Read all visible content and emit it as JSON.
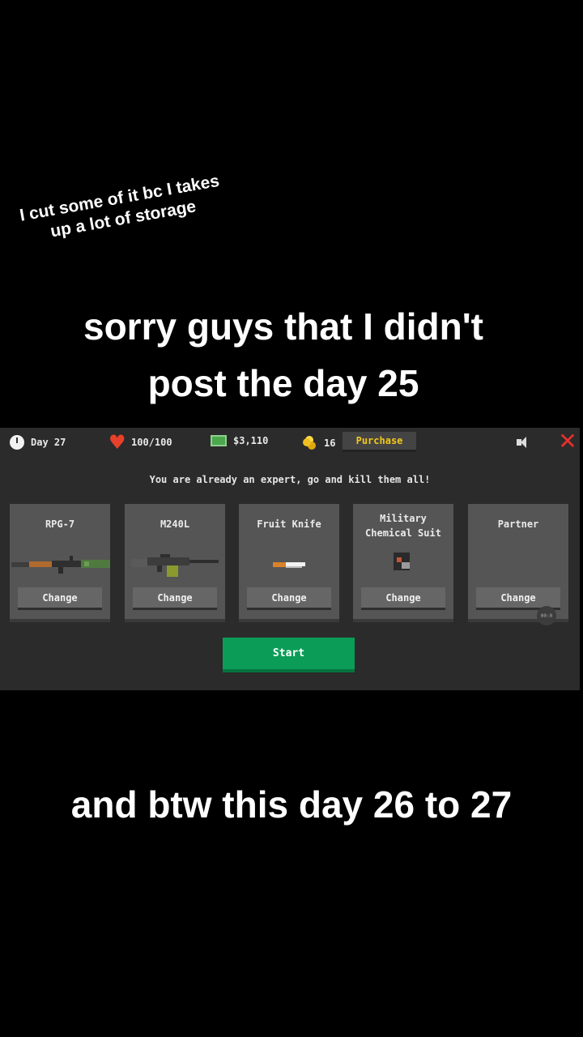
{
  "overlay": {
    "note_line1": "I cut some of it bc I takes",
    "note_line2": "up a lot of storage",
    "caption_top_line1": "sorry guys that I didn't",
    "caption_top_line2": "post the day 25",
    "caption_bottom": "and btw this day 26 to 27"
  },
  "hud": {
    "day": "Day 27",
    "health": "100/100",
    "cash": "$3,110",
    "coins": "16",
    "purchase_label": "Purchase",
    "icons": [
      "clock-icon",
      "heart-icon",
      "cash-icon",
      "coin-icon",
      "sound-icon",
      "close-icon"
    ]
  },
  "tagline": "You are already an expert, go and kill them all!",
  "loadout": [
    {
      "title": "RPG-7",
      "button": "Change"
    },
    {
      "title": "M240L",
      "button": "Change"
    },
    {
      "title": "Fruit Knife",
      "button": "Change"
    },
    {
      "title_line1": "Military",
      "title_line2": "Chemical Suit",
      "button": "Change"
    },
    {
      "title": "Partner",
      "button": "Change"
    }
  ],
  "badge_text": "00:0",
  "start_label": "Start",
  "colors": {
    "background": "#000000",
    "game_bg": "#2b2b2b",
    "card_bg": "#555555",
    "start_green": "#0b9d58",
    "purchase_text": "#f3c71a",
    "close_red": "#e8302a"
  }
}
